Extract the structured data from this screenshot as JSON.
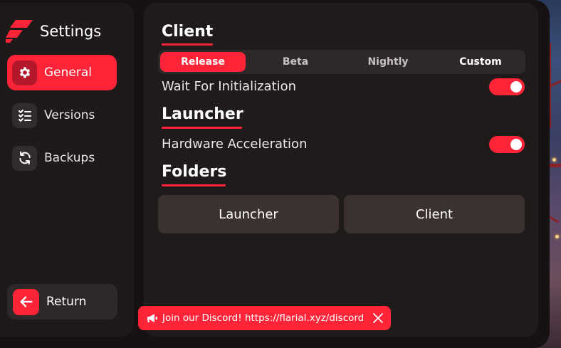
{
  "app": {
    "title": "Settings"
  },
  "sidebar": {
    "items": [
      {
        "label": "General",
        "icon": "gear-icon",
        "active": true
      },
      {
        "label": "Versions",
        "icon": "checklist-icon",
        "active": false
      },
      {
        "label": "Backups",
        "icon": "refresh-icon",
        "active": false
      }
    ],
    "return_label": "Return",
    "return_icon": "arrow-left-icon"
  },
  "sections": {
    "client": {
      "title": "Client",
      "channels": [
        "Release",
        "Beta",
        "Nightly",
        "Custom"
      ],
      "selected_channel": "Release",
      "wait_for_init_label": "Wait For Initialization",
      "wait_for_init_on": true
    },
    "launcher": {
      "title": "Launcher",
      "hw_accel_label": "Hardware Acceleration",
      "hw_accel_on": true
    },
    "folders": {
      "title": "Folders",
      "launcher_button": "Launcher",
      "client_button": "Client"
    }
  },
  "toast": {
    "icon": "megaphone-icon",
    "message": "Join our Discord! https://flarial.xyz/discord",
    "close_icon": "close-icon"
  },
  "colors": {
    "accent": "#ff2438",
    "panel": "#201b1b",
    "sidebar": "#1f1a1a",
    "button": "#3c3131"
  }
}
